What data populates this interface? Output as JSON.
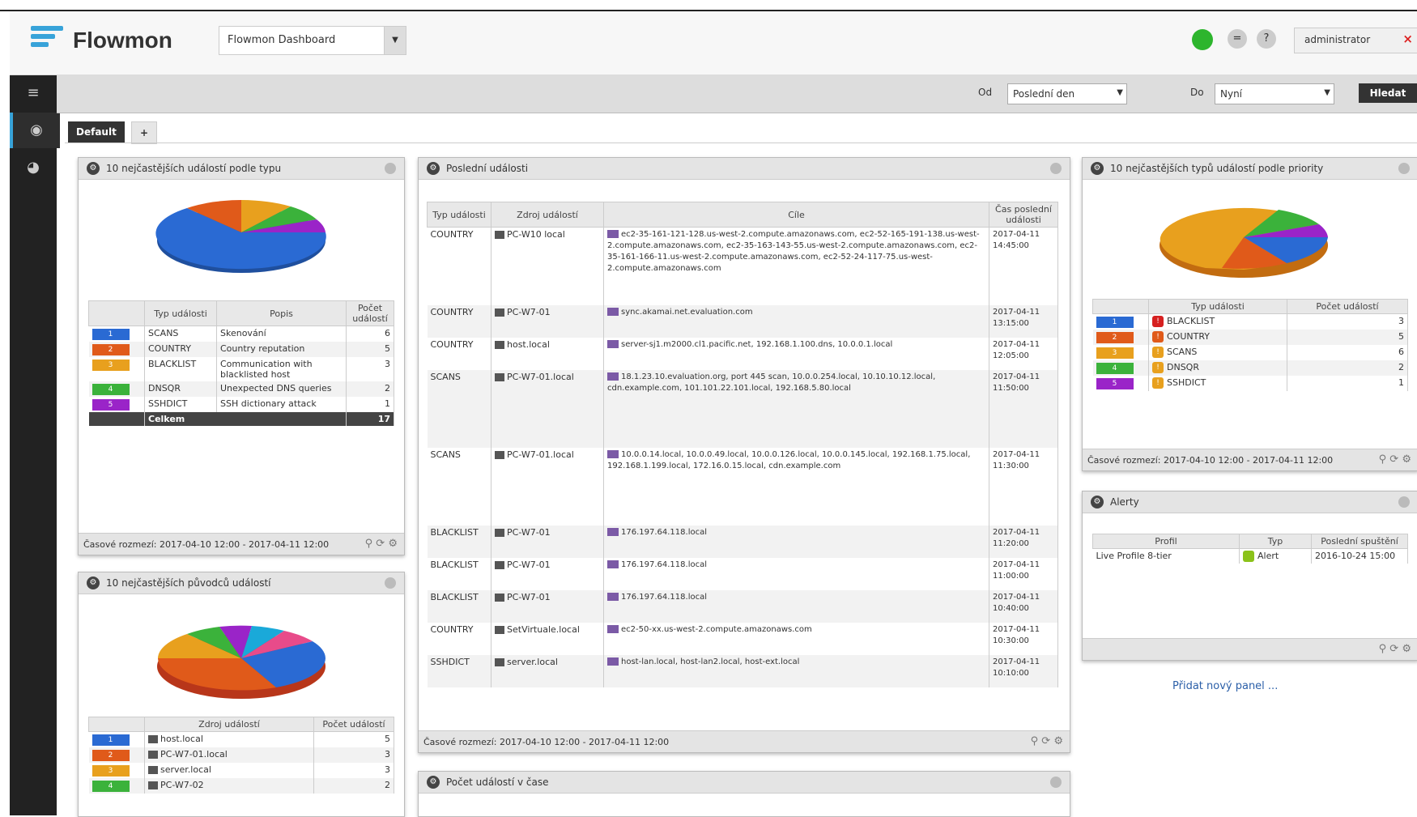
{
  "header": {
    "brand": "Flowmon",
    "dashboard_select": "Flowmon Dashboard",
    "status_eq": "=",
    "help": "?",
    "user": "administrator",
    "logout": "×"
  },
  "toolbar": {
    "from_label": "Od",
    "from_value": "Poslední den",
    "to_label": "Do",
    "to_value": "Nyní",
    "refresh": "Hledat"
  },
  "tabs": [
    {
      "label": "Default"
    },
    {
      "label": "+"
    }
  ],
  "panel_left1": {
    "title": "10 nejčastějších událostí podle typu",
    "columns": [
      "",
      "Typ události",
      "Popis",
      "Počet událostí"
    ],
    "rows": [
      {
        "id": "1",
        "color": "#2a6ad3",
        "type": "SCANS",
        "desc": "Skenování",
        "count": "6"
      },
      {
        "id": "2",
        "color": "#e05a1a",
        "type": "COUNTRY",
        "desc": "Country reputation",
        "count": "5"
      },
      {
        "id": "3",
        "color": "#e8a01e",
        "type": "BLACKLIST",
        "desc": "Communication with blacklisted host",
        "count": "3"
      },
      {
        "id": "4",
        "color": "#3bb23b",
        "type": "DNSQR",
        "desc": "Unexpected DNS queries",
        "count": "2"
      },
      {
        "id": "5",
        "color": "#9a24c8",
        "type": "SSHDICT",
        "desc": "SSH dictionary attack",
        "count": "1"
      }
    ],
    "total_label": "Celkem",
    "total_value": "17",
    "footer": "Časové rozmezí: 2017-04-10 12:00 - 2017-04-11 12:00"
  },
  "panel_left2": {
    "title": "10 nejčastějších původců událostí",
    "columns": [
      "",
      "Zdroj událostí",
      "Počet událostí"
    ],
    "rows": [
      {
        "id": "1",
        "color": "#2a6ad3",
        "src": "host.local",
        "count": "5"
      },
      {
        "id": "2",
        "color": "#e05a1a",
        "src": "PC-W7-01.local",
        "count": "3"
      },
      {
        "id": "3",
        "color": "#e8a01e",
        "src": "server.local",
        "count": "3"
      },
      {
        "id": "4",
        "color": "#3bb23b",
        "src": "PC-W7-02",
        "count": "2"
      }
    ]
  },
  "panel_mid": {
    "title": "Poslední události",
    "columns": [
      "Typ události",
      "Zdroj událostí",
      "Cíle",
      "Čas poslední události"
    ],
    "rows": [
      {
        "type": "COUNTRY",
        "src": "PC-W10 local",
        "targets": "ec2-35-161-121-128.us-west-2.compute.amazonaws.com, ec2-52-165-191-138.us-west-2.compute.amazonaws.com, ec2-35-163-143-55.us-west-2.compute.amazonaws.com, ec2-35-161-166-11.us-west-2.compute.amazonaws.com, ec2-52-24-117-75.us-west-2.compute.amazonaws.com",
        "time": "2017-04-11 14:45:00"
      },
      {
        "type": "COUNTRY",
        "src": "PC-W7-01",
        "targets": "sync.akamai.net.evaluation.com",
        "time": "2017-04-11 13:15:00"
      },
      {
        "type": "COUNTRY",
        "src": "host.local",
        "targets": "server-sj1.m2000.cl1.pacific.net, 192.168.1.100.dns, 10.0.0.1.local",
        "time": "2017-04-11 12:05:00"
      },
      {
        "type": "SCANS",
        "src": "PC-W7-01.local",
        "targets": "18.1.23.10.evaluation.org, port 445 scan, 10.0.0.254.local, 10.10.10.12.local, cdn.example.com, 101.101.22.101.local, 192.168.5.80.local",
        "time": "2017-04-11 11:50:00"
      },
      {
        "type": "SCANS",
        "src": "PC-W7-01.local",
        "targets": "10.0.0.14.local, 10.0.0.49.local, 10.0.0.126.local, 10.0.0.145.local, 192.168.1.75.local, 192.168.1.199.local, 172.16.0.15.local, cdn.example.com",
        "time": "2017-04-11 11:30:00"
      },
      {
        "type": "BLACKLIST",
        "src": "PC-W7-01",
        "targets": "176.197.64.118.local",
        "time": "2017-04-11 11:20:00"
      },
      {
        "type": "BLACKLIST",
        "src": "PC-W7-01",
        "targets": "176.197.64.118.local",
        "time": "2017-04-11 11:00:00"
      },
      {
        "type": "BLACKLIST",
        "src": "PC-W7-01",
        "targets": "176.197.64.118.local",
        "time": "2017-04-11 10:40:00"
      },
      {
        "type": "COUNTRY",
        "src": "SetVirtuale.local",
        "targets": "ec2-50-xx.us-west-2.compute.amazonaws.com",
        "time": "2017-04-11 10:30:00"
      },
      {
        "type": "SSHDICT",
        "src": "server.local",
        "targets": "host-lan.local, host-lan2.local, host-ext.local",
        "time": "2017-04-11 10:10:00"
      }
    ],
    "footer": "Časové rozmezí: 2017-04-10 12:00 - 2017-04-11 12:00"
  },
  "panel_mid2": {
    "title": "Počet událostí v čase"
  },
  "panel_right1": {
    "title": "10 nejčastějších typů událostí podle priority",
    "columns": [
      "",
      "Typ události",
      "Počet událostí"
    ],
    "rows": [
      {
        "id": "1",
        "color": "#2a6ad3",
        "badge": "#d62020",
        "type": "BLACKLIST",
        "count": "3"
      },
      {
        "id": "2",
        "color": "#e05a1a",
        "badge": "#e05a1a",
        "type": "COUNTRY",
        "count": "5"
      },
      {
        "id": "3",
        "color": "#e8a01e",
        "badge": "#e8a01e",
        "type": "SCANS",
        "count": "6"
      },
      {
        "id": "4",
        "color": "#3bb23b",
        "badge": "#e8a01e",
        "type": "DNSQR",
        "count": "2"
      },
      {
        "id": "5",
        "color": "#9a24c8",
        "badge": "#e8a01e",
        "type": "SSHDICT",
        "count": "1"
      }
    ],
    "footer": "Časové rozmezí: 2017-04-10 12:00 - 2017-04-11 12:00"
  },
  "panel_right2": {
    "title": "Alerty",
    "columns": [
      "Profil",
      "Typ",
      "Poslední spuštění"
    ],
    "rows": [
      {
        "profile": "Live  Profile 8-tier",
        "type": "Alert",
        "last": "2016-10-24 15:00"
      }
    ]
  },
  "add_panel": "Přidat nový panel ..."
}
